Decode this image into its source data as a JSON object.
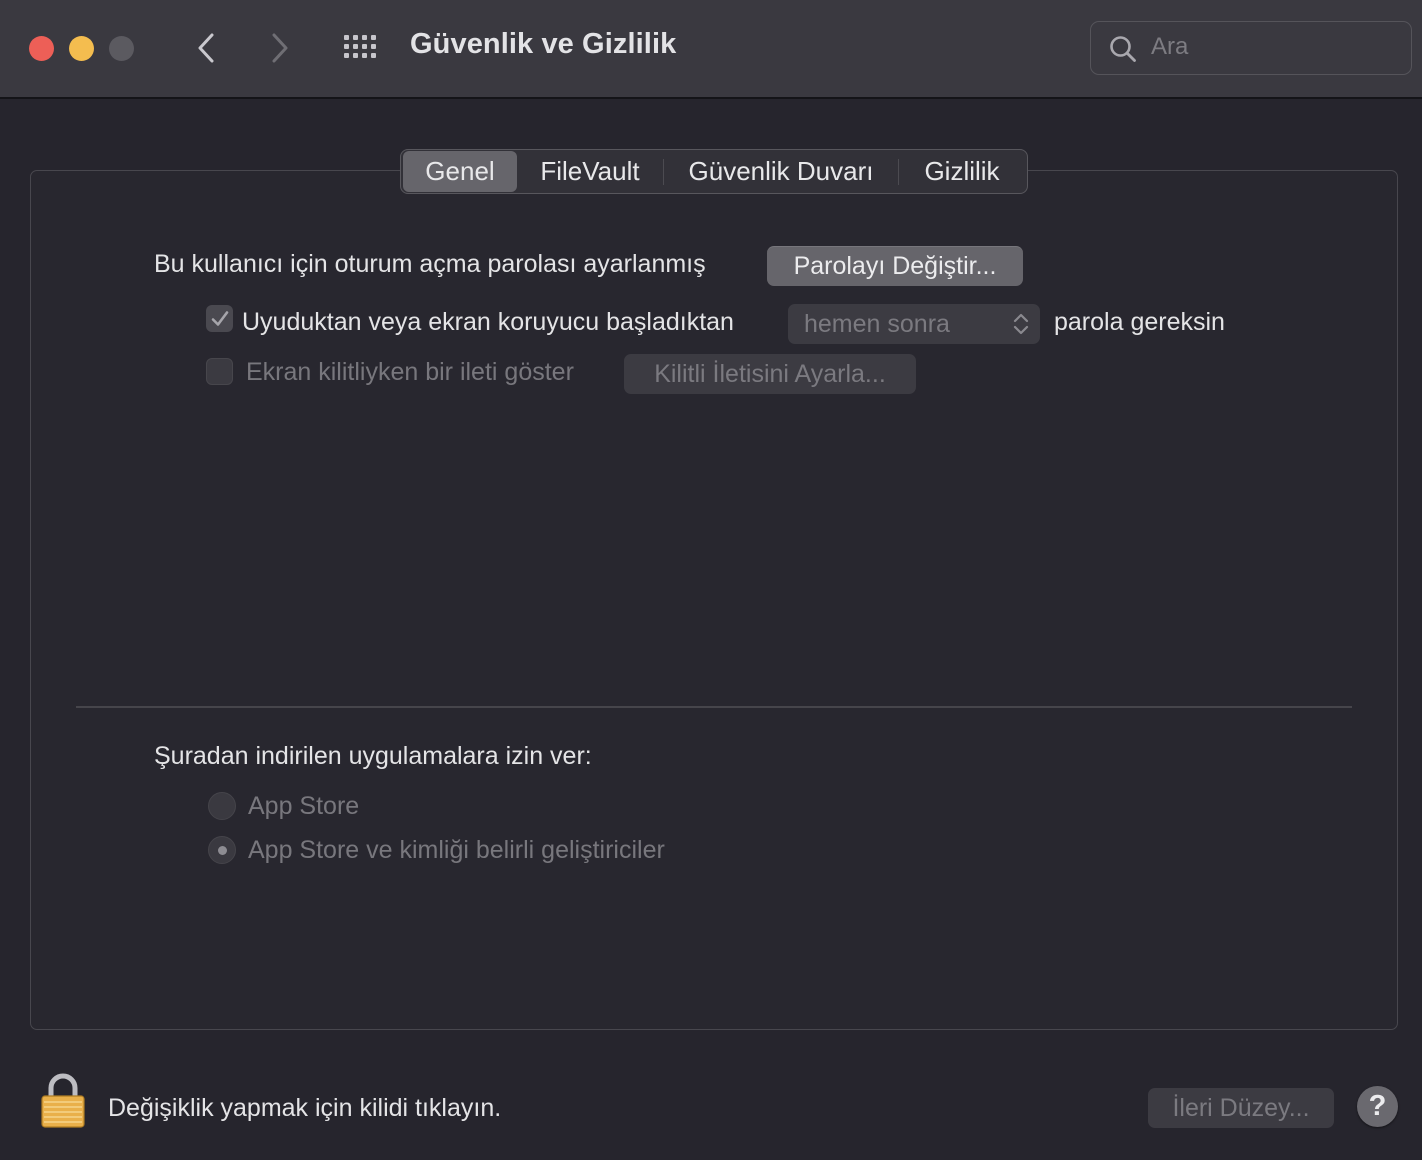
{
  "window": {
    "title": "Güvenlik ve Gizlilik"
  },
  "search": {
    "placeholder": "Ara",
    "value": ""
  },
  "tabs": [
    {
      "label": "Genel",
      "active": true
    },
    {
      "label": "FileVault",
      "active": false
    },
    {
      "label": "Güvenlik Duvarı",
      "active": false
    },
    {
      "label": "Gizlilik",
      "active": false
    }
  ],
  "general": {
    "password_set_text": "Bu kullanıcı için oturum açma parolası ayarlanmış",
    "change_password_button": "Parolayı Değiştir...",
    "require_password": {
      "checked": true,
      "label_before": "Uyuduktan veya ekran koruyucu başladıktan",
      "delay_value": "hemen sonra",
      "label_after": "parola gereksin"
    },
    "lock_message": {
      "checked": false,
      "label": "Ekran kilitliyken bir ileti göster",
      "button": "Kilitli İletisini Ayarla..."
    },
    "allow_apps": {
      "heading": "Şuradan indirilen uygulamalara izin ver:",
      "options": [
        {
          "label": "App Store",
          "selected": false
        },
        {
          "label": "App Store ve kimliği belirli geliştiriciler",
          "selected": true
        }
      ]
    }
  },
  "footer": {
    "lock_text": "Değişiklik yapmak için kilidi tıklayın.",
    "advanced_button": "İleri Düzey...",
    "help_label": "?"
  },
  "colors": {
    "close": "#ed5f57",
    "minimize": "#f4bd4f",
    "zoom_inactive": "#5b5a60",
    "lock_gold": "#e9b04a"
  },
  "icons": [
    "back-chevron-icon",
    "forward-chevron-icon",
    "grid-icon",
    "search-icon",
    "checkmark-icon",
    "popup-arrows-icon",
    "padlock-icon"
  ]
}
